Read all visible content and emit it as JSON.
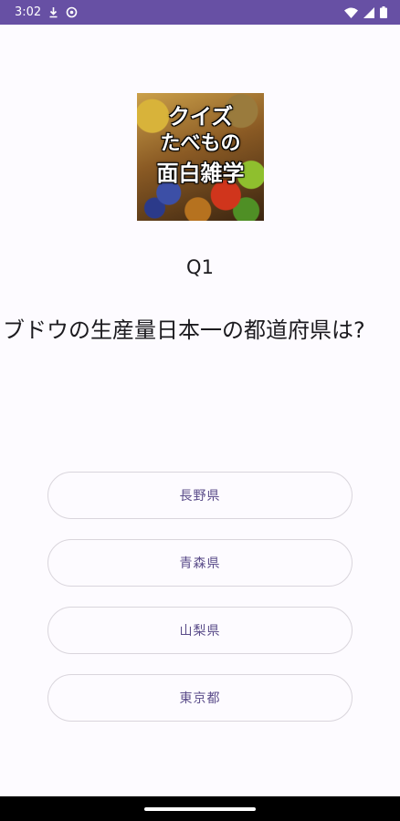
{
  "status_bar": {
    "time": "3:02",
    "icons": [
      "download-icon",
      "settings-gear-icon",
      "wifi-icon",
      "signal-icon",
      "battery-icon"
    ]
  },
  "logo": {
    "line1": "クイズ",
    "line2": "たべもの",
    "line3": "面白雑学"
  },
  "quiz": {
    "question_number": "Q1",
    "question_text": "ブドウの生産量日本一の都道府県は?",
    "answers": [
      "長野県",
      "青森県",
      "山梨県",
      "東京都"
    ]
  },
  "colors": {
    "status_bar": "#6750a4",
    "background": "#fdfbff",
    "button_text": "#5b4d8a",
    "button_border": "#d9d5dc",
    "nav_bar": "#000000"
  }
}
